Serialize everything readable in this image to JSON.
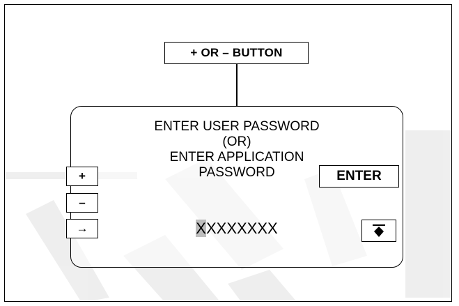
{
  "callout": {
    "label": "+ OR – BUTTON"
  },
  "screen": {
    "lines": [
      "ENTER USER PASSWORD",
      "(OR)",
      "ENTER APPLICATION",
      "PASSWORD"
    ],
    "password_first": "X",
    "password_rest": "XXXXXXX"
  },
  "buttons": {
    "plus": "+",
    "minus": "–",
    "arrow": "→",
    "enter": "ENTER"
  },
  "icons": {
    "top": "arrow-to-top-icon"
  },
  "colors": {
    "line": "#000000",
    "cursor_highlight": "#bdbdbd",
    "watermark": "#ebebeb"
  }
}
